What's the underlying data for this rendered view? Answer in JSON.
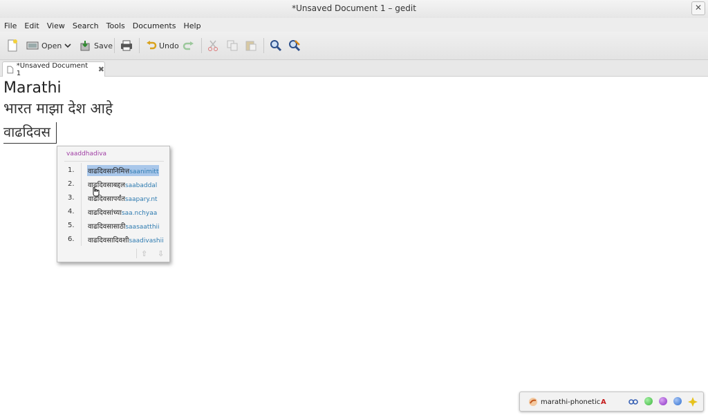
{
  "window": {
    "title": "*Unsaved Document 1 – gedit"
  },
  "menu": [
    "File",
    "Edit",
    "View",
    "Search",
    "Tools",
    "Documents",
    "Help"
  ],
  "toolbar": {
    "open": "Open",
    "save": "Save",
    "undo": "Undo"
  },
  "tab": {
    "label": "*Unsaved Document 1"
  },
  "document": {
    "line1": "Marathi",
    "line2": "भारत माझा देश आहे",
    "line3": "वाढदिवस"
  },
  "ime_popup": {
    "preedit": "vaaddhadiva",
    "candidates": [
      {
        "number": "1.",
        "devanagari": "वाढदिवसानिमित्त",
        "latin": "saanimitt"
      },
      {
        "number": "2.",
        "devanagari": "वाढदिवसाबद्दल",
        "latin": "saabaddal"
      },
      {
        "number": "3.",
        "devanagari": "वाढदिवसापर्यंत",
        "latin": "saapary.nt"
      },
      {
        "number": "4.",
        "devanagari": "वाढदिवसांच्या",
        "latin": "saa.nchyaa"
      },
      {
        "number": "5.",
        "devanagari": "वाढदिवसासाठी",
        "latin": "saasaatthii"
      },
      {
        "number": "6.",
        "devanagari": "वाढदिवसादिवशी",
        "latin": "saadivashii"
      }
    ],
    "selected_index": 0
  },
  "ime_status": {
    "engine": "marathi-phonetic",
    "mode_letter": "A",
    "dot_colors": [
      "#3bb53b",
      "#8a2fc2",
      "#2f6fd0"
    ]
  },
  "colors": {
    "accent_selection": "#a9c7ea",
    "preedit": "#a03fa5",
    "latin_hint": "#2e7bb0"
  }
}
